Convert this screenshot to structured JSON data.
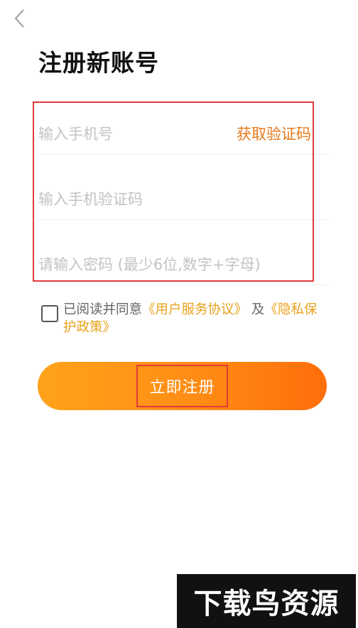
{
  "nav": {
    "back_icon": "chevron-left-icon"
  },
  "page": {
    "title": "注册新账号"
  },
  "form": {
    "phone_placeholder": "输入手机号",
    "get_code_label": "获取验证码",
    "code_placeholder": "输入手机验证码",
    "password_placeholder": "请输入密码 (最少6位,数字+字母)"
  },
  "agreement": {
    "prefix": "已阅读并同意",
    "user_agreement": "《用户服务协议》",
    "and": "及",
    "privacy_policy": "《隐私保护政策》",
    "checked": false
  },
  "register": {
    "label": "立即注册"
  },
  "watermark": {
    "text": "下载鸟资源"
  },
  "colors": {
    "accent": "#e7791b",
    "link": "#e7a21b",
    "button_start": "#ffa21a",
    "button_end": "#ff6e0a",
    "highlight": "#e23a3a"
  }
}
